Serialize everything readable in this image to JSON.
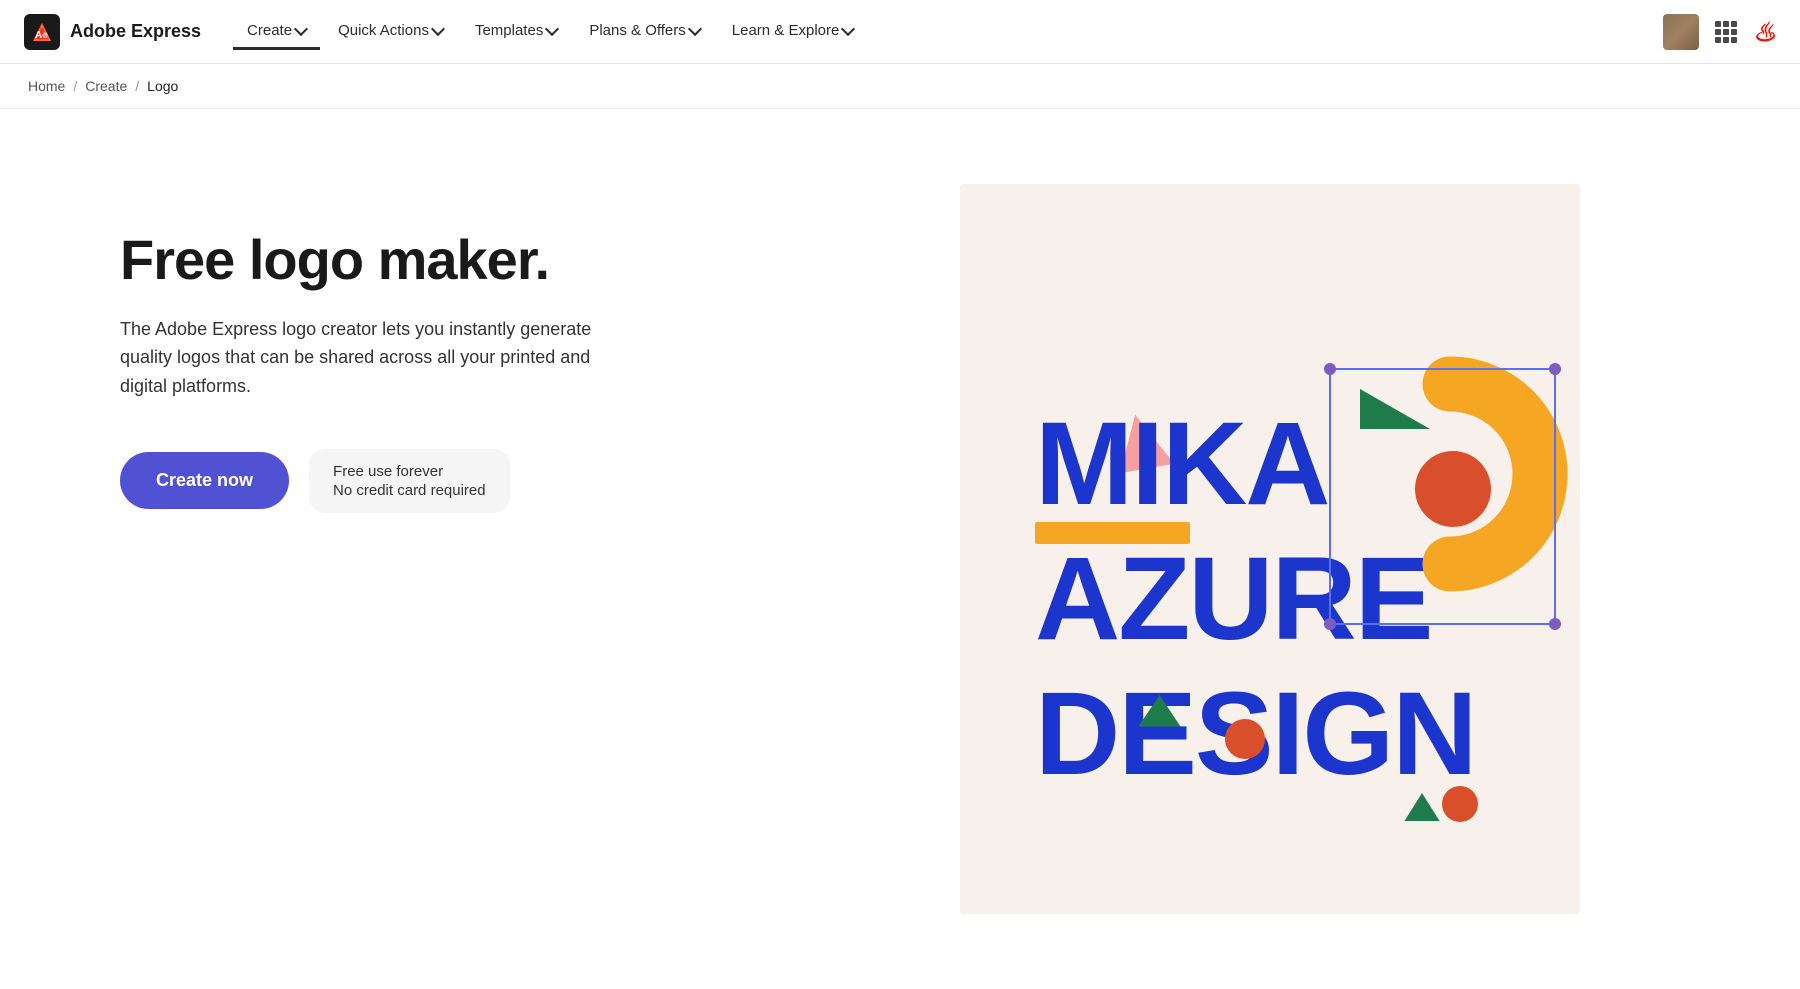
{
  "brand": {
    "name": "Adobe Express"
  },
  "navbar": {
    "items": [
      {
        "label": "Create",
        "active": true,
        "has_dropdown": true
      },
      {
        "label": "Quick Actions",
        "active": false,
        "has_dropdown": true
      },
      {
        "label": "Templates",
        "active": false,
        "has_dropdown": true
      },
      {
        "label": "Plans & Offers",
        "active": false,
        "has_dropdown": true
      },
      {
        "label": "Learn & Explore",
        "active": false,
        "has_dropdown": true
      }
    ]
  },
  "breadcrumb": {
    "items": [
      "Home",
      "Create",
      "Logo"
    ]
  },
  "hero": {
    "title": "Free logo maker.",
    "subtitle": "The Adobe Express logo creator lets you instantly generate quality logos that can be shared across all your printed and digital platforms.",
    "cta_button": "Create now",
    "free_line1": "Free use forever",
    "free_line2": "No credit card required"
  },
  "preview": {
    "alt": "MIKA AZURE DESIGN logo preview"
  }
}
